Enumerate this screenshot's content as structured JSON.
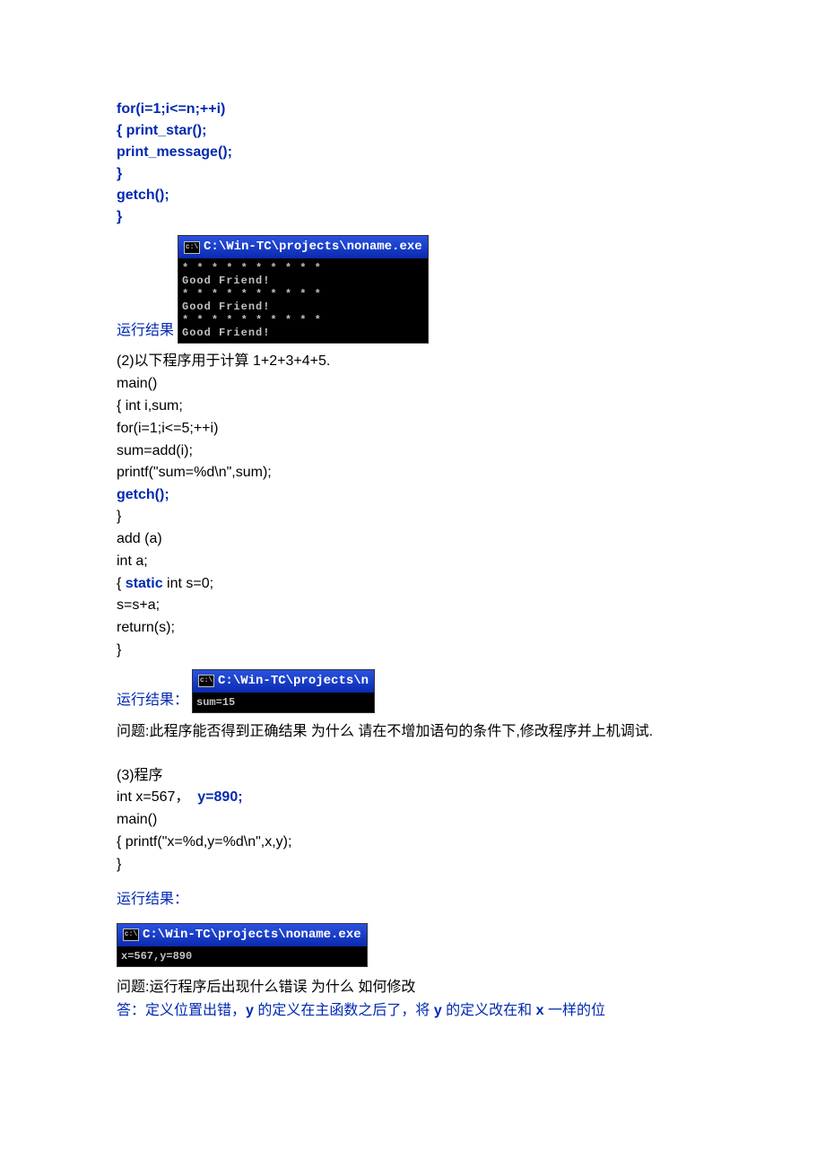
{
  "code1": {
    "lines": [
      "for(i=1;i<=n;++i)",
      "{ print_star();",
      "print_message();",
      "}",
      "getch();",
      "}"
    ]
  },
  "result_label": "运行结果",
  "result_label_colon": "运行结果：",
  "console1": {
    "title": "C:\\Win-TC\\projects\\noname.exe",
    "icon": "c:\\",
    "body": "* * * * * * * * * *\nGood Friend!\n* * * * * * * * * *\nGood Friend!\n* * * * * * * * * *\nGood Friend!"
  },
  "section2": {
    "intro": "(2)以下程序用于计算 1+2+3+4+5.",
    "lines_a": [
      "main()",
      "{ int i,sum;",
      "for(i=1;i<=5;++i)",
      "sum=add(i);",
      "printf(\"sum=%d\\n\",sum);"
    ],
    "getch": "getch();",
    "lines_b": [
      "}",
      "add (a)",
      "int a;"
    ],
    "static_prefix": "{ ",
    "static_keyword": "static",
    "static_suffix": " int s=0;",
    "lines_c": [
      "s=s+a;",
      "return(s);",
      "}"
    ]
  },
  "console2": {
    "title": "C:\\Win-TC\\projects\\n",
    "icon": "c:\\",
    "body": "sum=15"
  },
  "question2": "问题:此程序能否得到正确结果 为什么 请在不增加语句的条件下,修改程序并上机调试.",
  "section3": {
    "intro": "(3)程序",
    "line1_a": "int x=567，",
    "line1_b": "y=890;",
    "lines": [
      "main()",
      "{ printf(\"x=%d,y=%d\\n\",x,y);",
      "}"
    ]
  },
  "console3": {
    "title": "C:\\Win-TC\\projects\\noname.exe",
    "icon": "c:\\",
    "body": "x=567,y=890"
  },
  "question3": "问题:运行程序后出现什么错误 为什么 如何修改",
  "answer3": {
    "prefix": "答：定义位置出错，",
    "y1": "y",
    "mid": " 的定义在主函数之后了，将 ",
    "y2": "y",
    "mid2": " 的定义改在和 ",
    "x": "x",
    "suffix": " 一样的位"
  }
}
